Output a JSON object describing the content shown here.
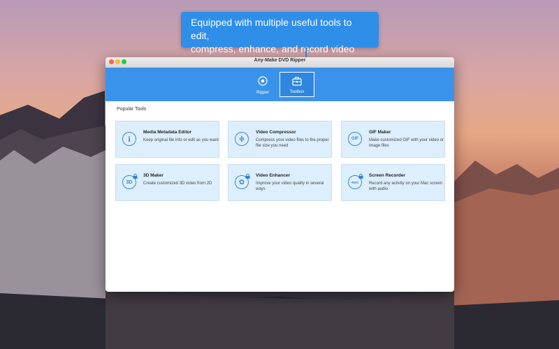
{
  "callout": {
    "line1": "Equipped with multiple useful tools to edit,",
    "line2": "compress, enhance, and record video"
  },
  "window": {
    "title": "Any-Make DVD Ripper"
  },
  "tabs": [
    {
      "label": "Ripper",
      "icon": "disc-icon",
      "active": false
    },
    {
      "label": "Toolbox",
      "icon": "toolbox-icon",
      "active": true
    }
  ],
  "section_title": "Popular Tools",
  "tools": [
    {
      "title": "Media Metadata Editor",
      "desc": "Keep original file info or edit as you want",
      "icon": "info-icon",
      "glyph": "i",
      "locked": false
    },
    {
      "title": "Video Compressor",
      "desc": "Compress your video files to the proper file size you need",
      "icon": "compress-icon",
      "glyph": "≑",
      "locked": false
    },
    {
      "title": "GIF Maker",
      "desc": "Make customized GIF with your video or image files",
      "icon": "gif-icon",
      "glyph": "GIF",
      "locked": false
    },
    {
      "title": "3D Maker",
      "desc": "Create customized 3D video from 2D",
      "icon": "3d-icon",
      "glyph": "3D",
      "locked": true
    },
    {
      "title": "Video Enhancer",
      "desc": "Improve your video quality in several ways",
      "icon": "palette-icon",
      "glyph": "✿",
      "locked": true
    },
    {
      "title": "Screen Recorder",
      "desc": "Record any activity on your Mac screen with audio",
      "icon": "rec-icon",
      "glyph": "•REC",
      "locked": true
    }
  ],
  "colors": {
    "accent": "#3a93ea",
    "card_bg": "#ddeefc",
    "icon": "#3a87d6"
  }
}
